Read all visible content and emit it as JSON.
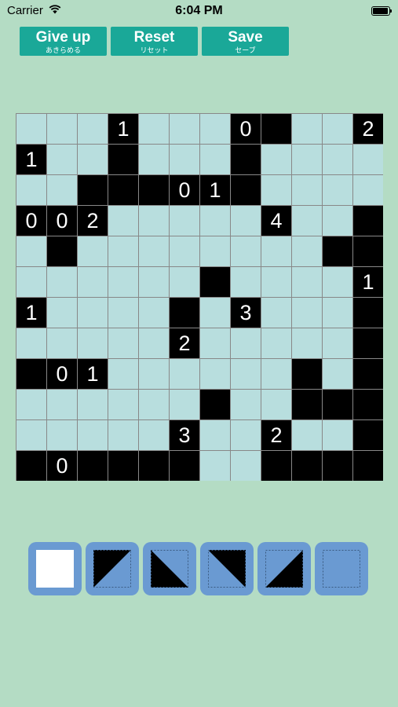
{
  "status_bar": {
    "carrier": "Carrier",
    "time": "6:04 PM"
  },
  "toolbar": {
    "give_up": {
      "label": "Give up",
      "sub": "あきらめる"
    },
    "reset": {
      "label": "Reset",
      "sub": "リセット"
    },
    "save": {
      "label": "Save",
      "sub": "セーブ"
    }
  },
  "board": {
    "size": 12,
    "rows": [
      [
        " ",
        " ",
        " ",
        "1",
        " ",
        " ",
        " ",
        "0",
        "#",
        " ",
        " ",
        "2"
      ],
      [
        "1",
        " ",
        " ",
        "#",
        " ",
        " ",
        " ",
        "#",
        " ",
        " ",
        " ",
        " "
      ],
      [
        " ",
        " ",
        "#",
        "#",
        "#",
        "0",
        "1",
        "#",
        " ",
        " ",
        " ",
        " "
      ],
      [
        "0",
        "0",
        "2",
        " ",
        " ",
        " ",
        " ",
        " ",
        "4",
        " ",
        " ",
        "#"
      ],
      [
        " ",
        "#",
        " ",
        " ",
        " ",
        " ",
        " ",
        " ",
        " ",
        " ",
        "#",
        "#"
      ],
      [
        " ",
        " ",
        " ",
        " ",
        " ",
        " ",
        "#",
        " ",
        " ",
        " ",
        " ",
        "1"
      ],
      [
        "1",
        " ",
        " ",
        " ",
        " ",
        "#",
        " ",
        "3",
        " ",
        " ",
        " ",
        "#"
      ],
      [
        " ",
        " ",
        " ",
        " ",
        " ",
        "2",
        " ",
        " ",
        " ",
        " ",
        " ",
        "#"
      ],
      [
        "#",
        "0",
        "1",
        " ",
        " ",
        " ",
        " ",
        " ",
        " ",
        "#",
        " ",
        "#"
      ],
      [
        " ",
        " ",
        " ",
        " ",
        " ",
        " ",
        "#",
        " ",
        " ",
        "#",
        "#",
        "#"
      ],
      [
        " ",
        " ",
        " ",
        " ",
        " ",
        "3",
        " ",
        " ",
        "2",
        " ",
        " ",
        "#"
      ],
      [
        "#",
        "0",
        "#",
        "#",
        "#",
        "#",
        " ",
        " ",
        "#",
        "#",
        "#",
        "#"
      ]
    ]
  },
  "palette": [
    {
      "name": "palette-empty-white",
      "icon": "white-square-icon"
    },
    {
      "name": "palette-triangle-bottom-left",
      "icon": "triangle-bottom-left-icon"
    },
    {
      "name": "palette-triangle-top-left",
      "icon": "triangle-top-left-icon"
    },
    {
      "name": "palette-triangle-top-right",
      "icon": "triangle-top-right-icon"
    },
    {
      "name": "palette-triangle-bottom-right",
      "icon": "triangle-bottom-right-icon"
    },
    {
      "name": "palette-dotted-blank",
      "icon": "dotted-square-icon"
    }
  ],
  "colors": {
    "background": "#b4dcc4",
    "button": "#1aa898",
    "cell": "#b8dede",
    "palette": "#6a9ad2"
  }
}
